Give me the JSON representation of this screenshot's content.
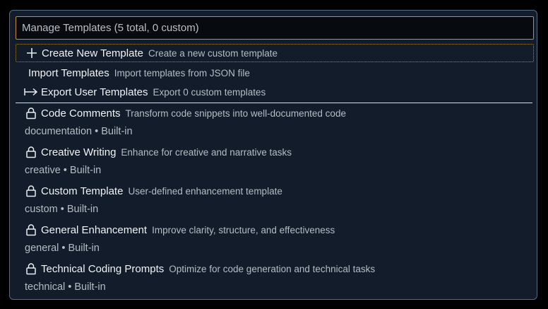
{
  "search": {
    "value": "Manage Templates (5 total, 0 custom)"
  },
  "actions": [
    {
      "icon": "plus-icon",
      "label": "Create New Template",
      "description": "Create a new custom template"
    },
    {
      "icon": "",
      "label": "Import Templates",
      "description": "Import templates from JSON file"
    },
    {
      "icon": "arrow-right-bar-icon",
      "label": "Export User Templates",
      "description": "Export 0 custom templates"
    }
  ],
  "templates": [
    {
      "icon": "lock-icon",
      "label": "Code Comments",
      "description": "Transform code snippets into well-documented code",
      "detail": "documentation • Built-in"
    },
    {
      "icon": "lock-icon",
      "label": "Creative Writing",
      "description": "Enhance for creative and narrative tasks",
      "detail": "creative • Built-in"
    },
    {
      "icon": "lock-icon",
      "label": "Custom Template",
      "description": "User-defined enhancement template",
      "detail": "custom • Built-in"
    },
    {
      "icon": "lock-icon",
      "label": "General Enhancement",
      "description": "Improve clarity, structure, and effectiveness",
      "detail": "general • Built-in"
    },
    {
      "icon": "lock-icon",
      "label": "Technical Coding Prompts",
      "description": "Optimize for code generation and technical tasks",
      "detail": "technical • Built-in"
    }
  ],
  "colors": {
    "panel_bg": "#121c2a",
    "panel_border": "#4f6f88",
    "search_border": "#c18a45",
    "selection_border": "#a5874c"
  }
}
